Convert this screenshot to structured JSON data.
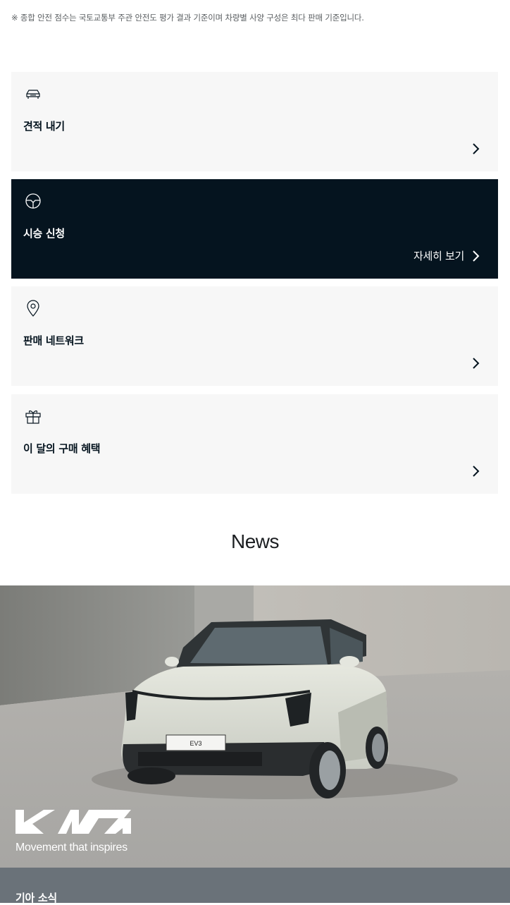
{
  "disclaimer": "※ 종합 안전 점수는 국토교통부 주관 안전도 평가 결과 기준이며 차량별 사양 구성은 최다 판매 기준입니다.",
  "cards": [
    {
      "title": "견적 내기",
      "icon": "car-icon"
    },
    {
      "title": "시승 신청",
      "icon": "steering-wheel-icon",
      "more_label": "자세히 보기",
      "active": true
    },
    {
      "title": "판매 네트워크",
      "icon": "location-pin-icon"
    },
    {
      "title": "이 달의 구매 혜택",
      "icon": "gift-icon"
    }
  ],
  "news": {
    "heading": "News",
    "hero": {
      "plate": "EV3",
      "brand_logo_text": "KIA",
      "tagline": "Movement that inspires"
    },
    "section_label": "기아 소식"
  },
  "colors": {
    "dark_card": "#05141f",
    "light_card": "#f7f7f7",
    "bottom_bar": "#6a7279"
  }
}
